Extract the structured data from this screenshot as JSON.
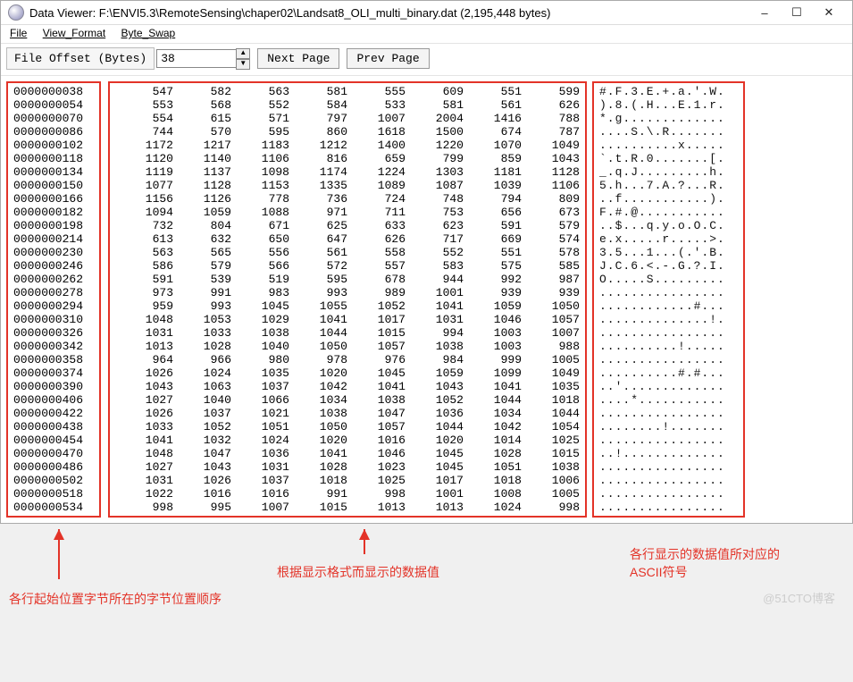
{
  "window": {
    "title": "Data Viewer: F:\\ENVI5.3\\RemoteSensing\\chaper02\\Landsat8_OLI_multi_binary.dat (2,195,448 bytes)"
  },
  "menu": {
    "file": "File",
    "view_format": "View_Format",
    "byte_swap": "Byte_Swap"
  },
  "toolbar": {
    "offset_label": "File Offset (Bytes)",
    "offset_value": "38",
    "next_page": "Next Page",
    "prev_page": "Prev Page"
  },
  "rows": [
    {
      "off": "0000000038",
      "v": [
        547,
        582,
        563,
        581,
        555,
        609,
        551,
        599
      ],
      "ascii": "#.F.3.E.+.a.'.W."
    },
    {
      "off": "0000000054",
      "v": [
        553,
        568,
        552,
        584,
        533,
        581,
        561,
        626
      ],
      "ascii": ").8.(.H...E.1.r."
    },
    {
      "off": "0000000070",
      "v": [
        554,
        615,
        571,
        797,
        1007,
        2004,
        1416,
        788
      ],
      "ascii": "*.g............."
    },
    {
      "off": "0000000086",
      "v": [
        744,
        570,
        595,
        860,
        1618,
        1500,
        674,
        787
      ],
      "ascii": "....S.\\.R......."
    },
    {
      "off": "0000000102",
      "v": [
        1172,
        1217,
        1183,
        1212,
        1400,
        1220,
        1070,
        1049
      ],
      "ascii": "..........x....."
    },
    {
      "off": "0000000118",
      "v": [
        1120,
        1140,
        1106,
        816,
        659,
        799,
        859,
        1043
      ],
      "ascii": "`.t.R.0.......[."
    },
    {
      "off": "0000000134",
      "v": [
        1119,
        1137,
        1098,
        1174,
        1224,
        1303,
        1181,
        1128
      ],
      "ascii": "_.q.J.........h."
    },
    {
      "off": "0000000150",
      "v": [
        1077,
        1128,
        1153,
        1335,
        1089,
        1087,
        1039,
        1106
      ],
      "ascii": "5.h...7.A.?...R."
    },
    {
      "off": "0000000166",
      "v": [
        1156,
        1126,
        778,
        736,
        724,
        748,
        794,
        809
      ],
      "ascii": "..f...........)."
    },
    {
      "off": "0000000182",
      "v": [
        1094,
        1059,
        1088,
        971,
        711,
        753,
        656,
        673
      ],
      "ascii": "F.#.@..........."
    },
    {
      "off": "0000000198",
      "v": [
        732,
        804,
        671,
        625,
        633,
        623,
        591,
        579
      ],
      "ascii": "..$...q.y.o.O.C."
    },
    {
      "off": "0000000214",
      "v": [
        613,
        632,
        650,
        647,
        626,
        717,
        669,
        574
      ],
      "ascii": "e.x.....r.....>."
    },
    {
      "off": "0000000230",
      "v": [
        563,
        565,
        556,
        561,
        558,
        552,
        551,
        578
      ],
      "ascii": "3.5...1...(.'.B."
    },
    {
      "off": "0000000246",
      "v": [
        586,
        579,
        566,
        572,
        557,
        583,
        575,
        585
      ],
      "ascii": "J.C.6.<.-.G.?.I."
    },
    {
      "off": "0000000262",
      "v": [
        591,
        539,
        519,
        595,
        678,
        944,
        992,
        987
      ],
      "ascii": "O.....S........."
    },
    {
      "off": "0000000278",
      "v": [
        973,
        991,
        983,
        993,
        989,
        1001,
        939,
        939
      ],
      "ascii": "................"
    },
    {
      "off": "0000000294",
      "v": [
        959,
        993,
        1045,
        1055,
        1052,
        1041,
        1059,
        1050
      ],
      "ascii": "............#..."
    },
    {
      "off": "0000000310",
      "v": [
        1048,
        1053,
        1029,
        1041,
        1017,
        1031,
        1046,
        1057
      ],
      "ascii": "..............!."
    },
    {
      "off": "0000000326",
      "v": [
        1031,
        1033,
        1038,
        1044,
        1015,
        994,
        1003,
        1007
      ],
      "ascii": "................"
    },
    {
      "off": "0000000342",
      "v": [
        1013,
        1028,
        1040,
        1050,
        1057,
        1038,
        1003,
        988
      ],
      "ascii": "..........!....."
    },
    {
      "off": "0000000358",
      "v": [
        964,
        966,
        980,
        978,
        976,
        984,
        999,
        1005
      ],
      "ascii": "................"
    },
    {
      "off": "0000000374",
      "v": [
        1026,
        1024,
        1035,
        1020,
        1045,
        1059,
        1099,
        1049
      ],
      "ascii": "..........#.#..."
    },
    {
      "off": "0000000390",
      "v": [
        1043,
        1063,
        1037,
        1042,
        1041,
        1043,
        1041,
        1035
      ],
      "ascii": "..'............."
    },
    {
      "off": "0000000406",
      "v": [
        1027,
        1040,
        1066,
        1034,
        1038,
        1052,
        1044,
        1018
      ],
      "ascii": "....*..........."
    },
    {
      "off": "0000000422",
      "v": [
        1026,
        1037,
        1021,
        1038,
        1047,
        1036,
        1034,
        1044
      ],
      "ascii": "................"
    },
    {
      "off": "0000000438",
      "v": [
        1033,
        1052,
        1051,
        1050,
        1057,
        1044,
        1042,
        1054
      ],
      "ascii": "........!......."
    },
    {
      "off": "0000000454",
      "v": [
        1041,
        1032,
        1024,
        1020,
        1016,
        1020,
        1014,
        1025
      ],
      "ascii": "................"
    },
    {
      "off": "0000000470",
      "v": [
        1048,
        1047,
        1036,
        1041,
        1046,
        1045,
        1028,
        1015
      ],
      "ascii": "..!............."
    },
    {
      "off": "0000000486",
      "v": [
        1027,
        1043,
        1031,
        1028,
        1023,
        1045,
        1051,
        1038
      ],
      "ascii": "................"
    },
    {
      "off": "0000000502",
      "v": [
        1031,
        1026,
        1037,
        1018,
        1025,
        1017,
        1018,
        1006
      ],
      "ascii": "................"
    },
    {
      "off": "0000000518",
      "v": [
        1022,
        1016,
        1016,
        991,
        998,
        1001,
        1008,
        1005
      ],
      "ascii": "................"
    },
    {
      "off": "0000000534",
      "v": [
        998,
        995,
        1007,
        1015,
        1013,
        1013,
        1024,
        998
      ],
      "ascii": "................"
    }
  ],
  "annotations": {
    "left": "各行起始位置字节所在的字节位置顺序",
    "middle": "根据显示格式而显示的数据值",
    "right": "各行显示的数据值所对应的ASCII符号"
  },
  "watermark": "@51CTO博客"
}
